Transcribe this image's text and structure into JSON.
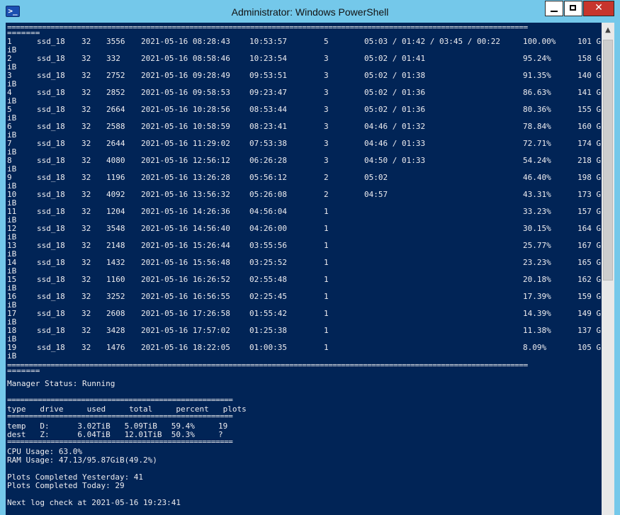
{
  "window": {
    "title": "Administrator: Windows PowerShell",
    "icon": "powershell-icon",
    "controls": {
      "minimize": "minimize-icon",
      "maximize": "maximize-icon",
      "close": "✕"
    }
  },
  "colors": {
    "console_bg": "#012456",
    "console_text": "#eeedf0",
    "titlebar": "#74c8ea",
    "close_button": "#c7352d"
  },
  "jobs_table": {
    "separator": "========================================================================================================================",
    "separator_tail": "=======",
    "rows": [
      {
        "id": "1",
        "queue": "ssd_18",
        "k": "32",
        "pid": "3556",
        "start": "2021-05-16 08:28:43",
        "elapsed": "10:53:57",
        "phase": "5",
        "phase_times": "05:03 / 01:42 / 03:45 / 00:22",
        "progress": "100.00%",
        "tmp": "101 G",
        "tail": "iB"
      },
      {
        "id": "2",
        "queue": "ssd_18",
        "k": "32",
        "pid": "332",
        "start": "2021-05-16 08:58:46",
        "elapsed": "10:23:54",
        "phase": "3",
        "phase_times": "05:02 / 01:41",
        "progress": "95.24%",
        "tmp": "158 G",
        "tail": "iB"
      },
      {
        "id": "3",
        "queue": "ssd_18",
        "k": "32",
        "pid": "2752",
        "start": "2021-05-16 09:28:49",
        "elapsed": "09:53:51",
        "phase": "3",
        "phase_times": "05:02 / 01:38",
        "progress": "91.35%",
        "tmp": "140 G",
        "tail": "iB"
      },
      {
        "id": "4",
        "queue": "ssd_18",
        "k": "32",
        "pid": "2852",
        "start": "2021-05-16 09:58:53",
        "elapsed": "09:23:47",
        "phase": "3",
        "phase_times": "05:02 / 01:36",
        "progress": "86.63%",
        "tmp": "141 G",
        "tail": "iB"
      },
      {
        "id": "5",
        "queue": "ssd_18",
        "k": "32",
        "pid": "2664",
        "start": "2021-05-16 10:28:56",
        "elapsed": "08:53:44",
        "phase": "3",
        "phase_times": "05:02 / 01:36",
        "progress": "80.36%",
        "tmp": "155 G",
        "tail": "iB"
      },
      {
        "id": "6",
        "queue": "ssd_18",
        "k": "32",
        "pid": "2588",
        "start": "2021-05-16 10:58:59",
        "elapsed": "08:23:41",
        "phase": "3",
        "phase_times": "04:46 / 01:32",
        "progress": "78.84%",
        "tmp": "160 G",
        "tail": "iB"
      },
      {
        "id": "7",
        "queue": "ssd_18",
        "k": "32",
        "pid": "2644",
        "start": "2021-05-16 11:29:02",
        "elapsed": "07:53:38",
        "phase": "3",
        "phase_times": "04:46 / 01:33",
        "progress": "72.71%",
        "tmp": "174 G",
        "tail": "iB"
      },
      {
        "id": "8",
        "queue": "ssd_18",
        "k": "32",
        "pid": "4080",
        "start": "2021-05-16 12:56:12",
        "elapsed": "06:26:28",
        "phase": "3",
        "phase_times": "04:50 / 01:33",
        "progress": "54.24%",
        "tmp": "218 G",
        "tail": "iB"
      },
      {
        "id": "9",
        "queue": "ssd_18",
        "k": "32",
        "pid": "1196",
        "start": "2021-05-16 13:26:28",
        "elapsed": "05:56:12",
        "phase": "2",
        "phase_times": "05:02",
        "progress": "46.40%",
        "tmp": "198 G",
        "tail": "iB"
      },
      {
        "id": "10",
        "queue": "ssd_18",
        "k": "32",
        "pid": "4092",
        "start": "2021-05-16 13:56:32",
        "elapsed": "05:26:08",
        "phase": "2",
        "phase_times": "04:57",
        "progress": "43.31%",
        "tmp": "173 G",
        "tail": "iB"
      },
      {
        "id": "11",
        "queue": "ssd_18",
        "k": "32",
        "pid": "1204",
        "start": "2021-05-16 14:26:36",
        "elapsed": "04:56:04",
        "phase": "1",
        "phase_times": "",
        "progress": "33.23%",
        "tmp": "157 G",
        "tail": "iB"
      },
      {
        "id": "12",
        "queue": "ssd_18",
        "k": "32",
        "pid": "3548",
        "start": "2021-05-16 14:56:40",
        "elapsed": "04:26:00",
        "phase": "1",
        "phase_times": "",
        "progress": "30.15%",
        "tmp": "164 G",
        "tail": "iB"
      },
      {
        "id": "13",
        "queue": "ssd_18",
        "k": "32",
        "pid": "2148",
        "start": "2021-05-16 15:26:44",
        "elapsed": "03:55:56",
        "phase": "1",
        "phase_times": "",
        "progress": "25.77%",
        "tmp": "167 G",
        "tail": "iB"
      },
      {
        "id": "14",
        "queue": "ssd_18",
        "k": "32",
        "pid": "1432",
        "start": "2021-05-16 15:56:48",
        "elapsed": "03:25:52",
        "phase": "1",
        "phase_times": "",
        "progress": "23.23%",
        "tmp": "165 G",
        "tail": "iB"
      },
      {
        "id": "15",
        "queue": "ssd_18",
        "k": "32",
        "pid": "1160",
        "start": "2021-05-16 16:26:52",
        "elapsed": "02:55:48",
        "phase": "1",
        "phase_times": "",
        "progress": "20.18%",
        "tmp": "162 G",
        "tail": "iB"
      },
      {
        "id": "16",
        "queue": "ssd_18",
        "k": "32",
        "pid": "3252",
        "start": "2021-05-16 16:56:55",
        "elapsed": "02:25:45",
        "phase": "1",
        "phase_times": "",
        "progress": "17.39%",
        "tmp": "159 G",
        "tail": "iB"
      },
      {
        "id": "17",
        "queue": "ssd_18",
        "k": "32",
        "pid": "2608",
        "start": "2021-05-16 17:26:58",
        "elapsed": "01:55:42",
        "phase": "1",
        "phase_times": "",
        "progress": "14.39%",
        "tmp": "149 G",
        "tail": "iB"
      },
      {
        "id": "18",
        "queue": "ssd_18",
        "k": "32",
        "pid": "3428",
        "start": "2021-05-16 17:57:02",
        "elapsed": "01:25:38",
        "phase": "1",
        "phase_times": "",
        "progress": "11.38%",
        "tmp": "137 G",
        "tail": "iB"
      },
      {
        "id": "19",
        "queue": "ssd_18",
        "k": "32",
        "pid": "1476",
        "start": "2021-05-16 18:22:05",
        "elapsed": "01:00:35",
        "phase": "1",
        "phase_times": "",
        "progress": "8.09%",
        "tmp": "105 G",
        "tail": "iB"
      }
    ]
  },
  "manager_status": "Manager Status: Running",
  "drives": {
    "separator": "====================================================",
    "header": "type   drive     used     total     percent   plots",
    "rows": [
      "temp   D:      3.02TiB   5.09TiB   59.4%     19",
      "dest   Z:      6.04TiB   12.01TiB  50.3%     ?"
    ]
  },
  "system": {
    "cpu": "CPU Usage: 63.0%",
    "ram": "RAM Usage: 47.13/95.87GiB(49.2%)"
  },
  "plots": {
    "yesterday": "Plots Completed Yesterday: 41",
    "today": "Plots Completed Today: 29"
  },
  "next_log_check": "Next log check at 2021-05-16 19:23:41"
}
